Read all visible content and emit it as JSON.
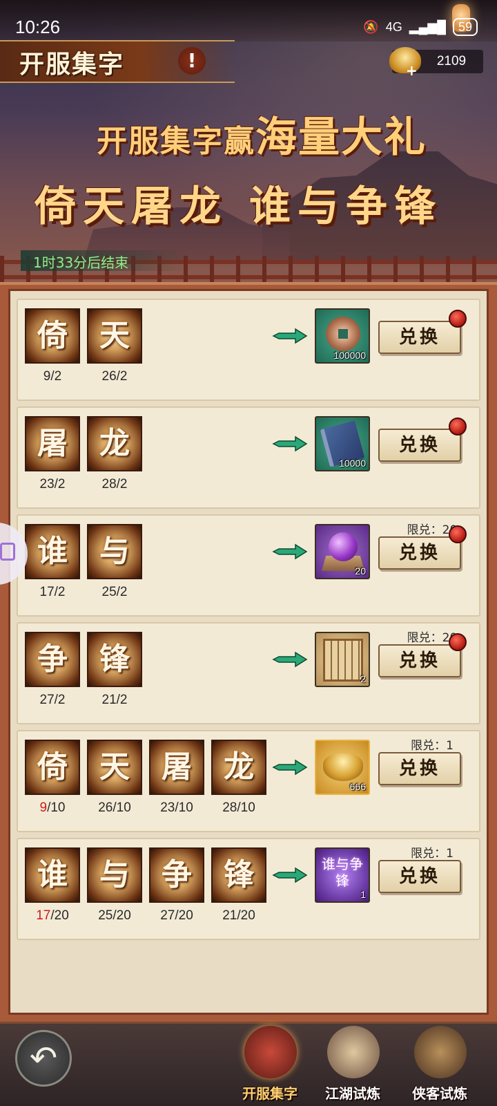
{
  "status_bar": {
    "time": "10:26",
    "network": "4G",
    "battery": "59"
  },
  "header": {
    "title": "开服集字",
    "info_label": "!",
    "currency_value": "2109",
    "currency_plus": "+"
  },
  "banner": {
    "line1_part1": "开服集字赢",
    "line1_part2": "海量大礼",
    "line2": "倚天屠龙 谁与争锋",
    "timer": "1时33分后结束"
  },
  "rows": [
    {
      "chars": [
        {
          "char": "倚",
          "have": "9",
          "need": "2"
        },
        {
          "char": "天",
          "have": "26",
          "need": "2"
        }
      ],
      "reward": {
        "icon": "copper-coin-icon",
        "qty": "100000"
      },
      "limit": "",
      "button": "兑换",
      "red_dot": true
    },
    {
      "chars": [
        {
          "char": "屠",
          "have": "23",
          "need": "2"
        },
        {
          "char": "龙",
          "have": "28",
          "need": "2"
        }
      ],
      "reward": {
        "icon": "book-icon",
        "qty": "10000"
      },
      "limit": "",
      "button": "兑换",
      "red_dot": true
    },
    {
      "chars": [
        {
          "char": "谁",
          "have": "17",
          "need": "2"
        },
        {
          "char": "与",
          "have": "25",
          "need": "2"
        }
      ],
      "reward": {
        "icon": "purple-orb-icon",
        "qty": "20"
      },
      "limit": "限兑：20",
      "button": "兑换",
      "red_dot": true
    },
    {
      "chars": [
        {
          "char": "争",
          "have": "27",
          "need": "2"
        },
        {
          "char": "锋",
          "have": "21",
          "need": "2"
        }
      ],
      "reward": {
        "icon": "scroll-icon",
        "qty": "2"
      },
      "limit": "限兑：20",
      "button": "兑换",
      "red_dot": true
    },
    {
      "chars": [
        {
          "char": "倚",
          "have": "9",
          "need": "10"
        },
        {
          "char": "天",
          "have": "26",
          "need": "10"
        },
        {
          "char": "屠",
          "have": "23",
          "need": "10"
        },
        {
          "char": "龙",
          "have": "28",
          "need": "10"
        }
      ],
      "reward": {
        "icon": "gold-ingot-icon",
        "qty": "666"
      },
      "limit": "限兑：1",
      "button": "兑换",
      "red_dot": false
    },
    {
      "chars": [
        {
          "char": "谁",
          "have": "17",
          "need": "20"
        },
        {
          "char": "与",
          "have": "25",
          "need": "20"
        },
        {
          "char": "争",
          "have": "27",
          "need": "20"
        },
        {
          "char": "锋",
          "have": "21",
          "need": "20"
        }
      ],
      "reward": {
        "icon": "title-card-icon",
        "qty": "1",
        "card_text": "谁与争锋"
      },
      "limit": "限兑：1",
      "button": "兑换",
      "red_dot": false
    }
  ],
  "bottom_nav": {
    "back": "back-arrow-icon",
    "tabs": [
      {
        "label": "开服集字",
        "active": true
      },
      {
        "label": "江湖试炼",
        "active": false
      },
      {
        "label": "侠客试炼",
        "active": false
      }
    ]
  },
  "colors": {
    "shortage": "#d01a1a",
    "timer": "#8cf08c",
    "red_dot": "#c8201a"
  }
}
